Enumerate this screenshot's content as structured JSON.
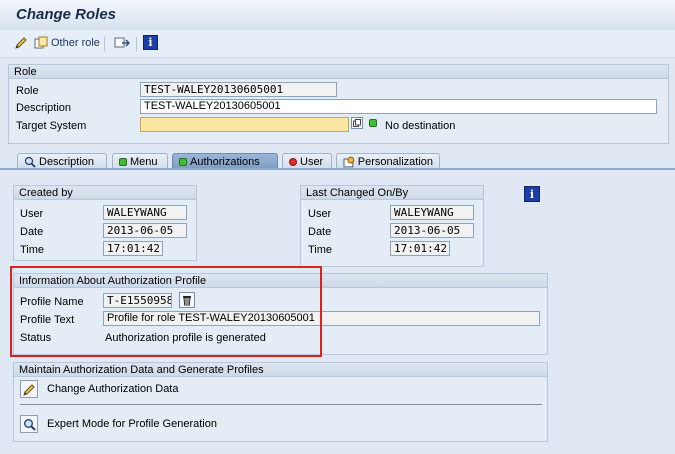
{
  "window": {
    "title": "Change Roles"
  },
  "toolbar": {
    "other_role": "Other role"
  },
  "role_group": {
    "heading": "Role",
    "role_label": "Role",
    "role_value": "TEST-WALEY20130605001",
    "description_label": "Description",
    "description_value": "TEST-WALEY20130605001",
    "target_system_label": "Target System",
    "target_system_value": "",
    "no_destination": "No destination"
  },
  "tabs": [
    {
      "label": "Description",
      "icon": "magnifier-icon"
    },
    {
      "label": "Menu",
      "icon": "green-status-icon"
    },
    {
      "label": "Authorizations",
      "icon": "green-status-icon",
      "active": true
    },
    {
      "label": "User",
      "icon": "red-status-icon"
    },
    {
      "label": "Personalization",
      "icon": "personalization-icon"
    }
  ],
  "created_by": {
    "heading": "Created by",
    "user_label": "User",
    "user_value": "WALEYWANG",
    "date_label": "Date",
    "date_value": "2013-06-05",
    "time_label": "Time",
    "time_value": "17:01:42"
  },
  "last_changed": {
    "heading": "Last Changed On/By",
    "user_label": "User",
    "user_value": "WALEYWANG",
    "date_label": "Date",
    "date_value": "2013-06-05",
    "time_label": "Time",
    "time_value": "17:01:42"
  },
  "profile_info": {
    "heading": "Information About Authorization Profile",
    "name_label": "Profile Name",
    "name_value": "T-E1550958",
    "text_label": "Profile Text",
    "text_value": "Profile for role TEST-WALEY20130605001",
    "status_label": "Status",
    "status_value": "Authorization profile is generated"
  },
  "maintain": {
    "heading": "Maintain Authorization Data and Generate Profiles",
    "change_label": "Change Authorization Data",
    "expert_label": "Expert Mode for Profile Generation"
  },
  "colors": {
    "highlight_frame": "#e0201c",
    "active_tab": "#8aa8cd",
    "required_field": "#fbe7a1"
  }
}
